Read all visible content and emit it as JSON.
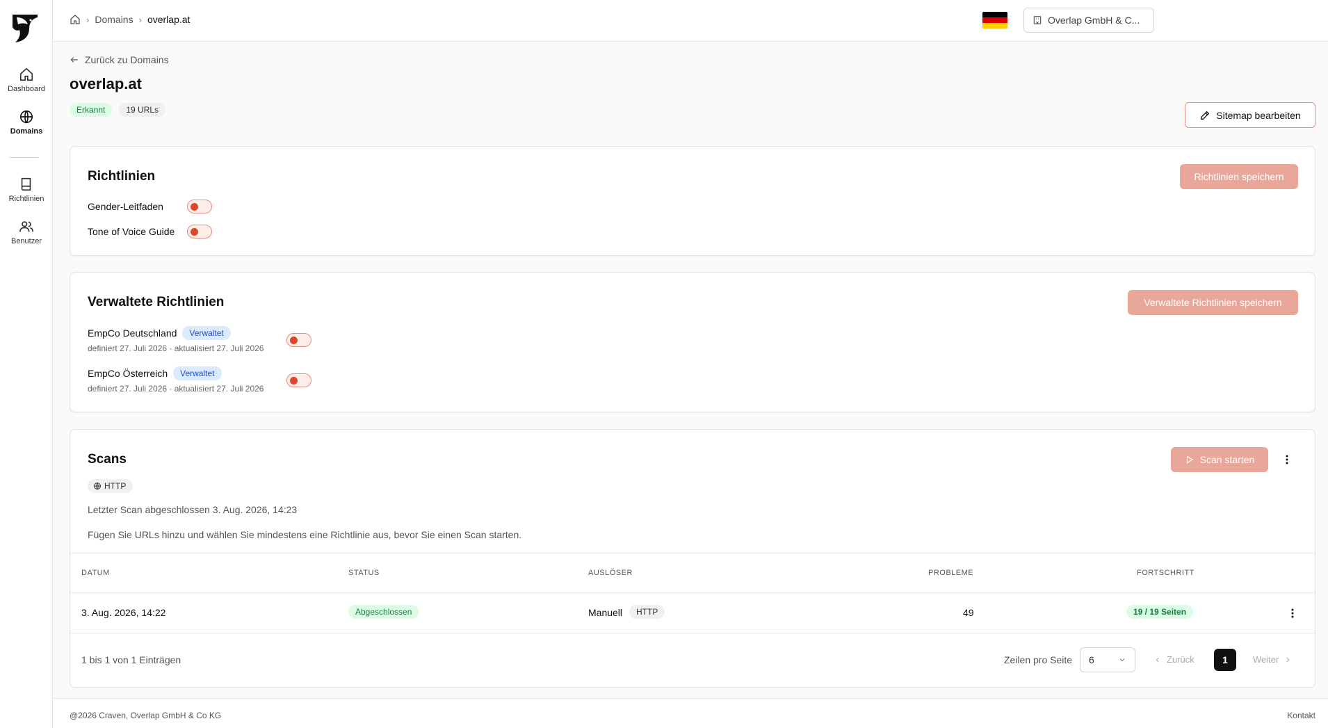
{
  "sidebar": {
    "items": [
      {
        "label": "Dashboard",
        "icon": "home-icon"
      },
      {
        "label": "Domains",
        "icon": "globe-icon"
      },
      {
        "label": "Richtlinien",
        "icon": "book-icon"
      },
      {
        "label": "Benutzer",
        "icon": "users-icon"
      }
    ]
  },
  "header": {
    "breadcrumb": [
      "Domains",
      "overlap.at"
    ],
    "language_flag": "de-flag",
    "org": "Overlap GmbH & C..."
  },
  "page": {
    "back_label": "Zurück zu Domains",
    "title": "overlap.at",
    "status_badge": "Erkannt",
    "url_count": "19 URLs",
    "sitemap_button": "Sitemap bearbeiten"
  },
  "policies": {
    "title": "Richtlinien",
    "save_button": "Richtlinien speichern",
    "items": [
      {
        "label": "Gender-Leitfaden",
        "enabled": false
      },
      {
        "label": "Tone of Voice Guide",
        "enabled": false
      }
    ]
  },
  "managed": {
    "title": "Verwaltete Richtlinien",
    "save_button": "Verwaltete Richtlinien speichern",
    "items": [
      {
        "name": "EmpCo Deutschland",
        "badge": "Verwaltet",
        "meta": "definiert 27. Juli 2026 · aktualisiert 27. Juli 2026",
        "enabled": false
      },
      {
        "name": "EmpCo Österreich",
        "badge": "Verwaltet",
        "meta": "definiert 27. Juli 2026 · aktualisiert 27. Juli 2026",
        "enabled": false
      }
    ]
  },
  "scans": {
    "title": "Scans",
    "start_button": "Scan starten",
    "protocol": "HTTP",
    "last_scan": "Letzter Scan abgeschlossen 3. Aug. 2026, 14:23",
    "hint": "Fügen Sie URLs hinzu und wählen Sie mindestens eine Richtlinie aus, bevor Sie einen Scan starten.",
    "columns": [
      "DATUM",
      "STATUS",
      "AUSLÖSER",
      "PROBLEME",
      "FORTSCHRITT"
    ],
    "rows": [
      {
        "date": "3. Aug. 2026, 14:22",
        "status": "Abgeschlossen",
        "trigger": "Manuell",
        "trigger_protocol": "HTTP",
        "issues": "49",
        "progress": "19 / 19 Seiten"
      }
    ],
    "footer": {
      "info": "1 bis 1 von 1 Einträgen",
      "rows_label": "Zeilen pro Seite",
      "rows_value": "6",
      "prev": "Zurück",
      "page": "1",
      "next": "Weiter"
    }
  },
  "footer": {
    "copyright": "@2026 Craven, Overlap GmbH & Co KG",
    "contact": "Kontakt"
  },
  "colors": {
    "accent": "#e9a799",
    "accent_border": "#e88c7c",
    "toggle_knob": "#d9472b",
    "success_bg": "#dcfce7",
    "success_text": "#15803d",
    "managed_bg": "#dbeafe",
    "managed_text": "#1d4ed8"
  }
}
